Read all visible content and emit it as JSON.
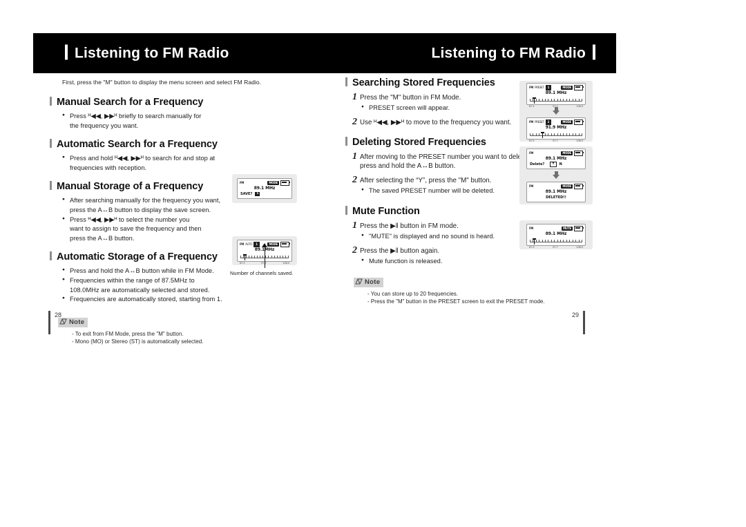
{
  "header": {
    "left_title": "Listening to FM Radio",
    "right_title": "Listening to FM Radio"
  },
  "left_page": {
    "intro": "First, press the \"M\" button to display the menu screen and select FM Radio.",
    "page_number": "28",
    "sections": [
      {
        "heading": "Manual Search for a Frequency",
        "bullets": [
          "Press ᴴ◀◀, ▶▶ᴴ briefly to search manually for",
          "the frequency you want."
        ]
      },
      {
        "heading": "Automatic Search for a Frequency",
        "bullets": [
          "Press and hold ᴴ◀◀, ▶▶ᴴ to search for and stop at",
          "frequencies with reception."
        ]
      },
      {
        "heading": "Manual Storage of a Frequency",
        "bullets": [
          "After searching manually for the frequency you want,",
          "press the A↔B button to display the save screen.",
          "Press ᴴ◀◀, ▶▶ᴴ to select the number you",
          "want to assign to save the frequency and then",
          "press the A↔B button."
        ]
      },
      {
        "heading": "Automatic Storage of a Frequency",
        "bullets": [
          "Press and hold the A↔B button while in FM Mode.",
          "Frequencies within the range of 87.5MHz to",
          "108.0MHz are automatically selected and stored.",
          "Frequencies are automatically stored, starting from 1."
        ]
      }
    ],
    "note": {
      "title": "Note",
      "items": [
        "- To exit from FM Mode, press the \"M\" button.",
        "- Mono (MO) or Stereo (ST) is automatically selected."
      ]
    },
    "callout": "Number of channels saved."
  },
  "right_page": {
    "page_number": "29",
    "sections": [
      {
        "heading": "Searching Stored Frequencies",
        "steps": [
          {
            "num": "1",
            "text": "Press the \"M\" button in FM Mode.",
            "sub": [
              "PRESET screen will appear."
            ]
          },
          {
            "num": "2",
            "text": "Use ᴴ◀◀, ▶▶ᴴ to move to the frequency you want.",
            "sub": []
          }
        ]
      },
      {
        "heading": "Deleting Stored Frequencies",
        "steps": [
          {
            "num": "1",
            "text": "After moving to the PRESET number you want to delete,",
            "text2": "press and hold the A↔B button.",
            "sub": []
          },
          {
            "num": "2",
            "text": "After selecting the “Y”, press the \"M\" button.",
            "sub": [
              "The saved PRESET number will be deleted."
            ]
          }
        ]
      },
      {
        "heading": "Mute Function",
        "steps": [
          {
            "num": "1",
            "text": "Press the ▶‖ button in FM mode.",
            "sub": [
              "\"MUTE\" is displayed and no sound is heard."
            ]
          },
          {
            "num": "2",
            "text": "Press the ▶‖ button again.",
            "sub": [
              "Mute function is released."
            ]
          }
        ]
      }
    ],
    "note": {
      "title": "Note",
      "items": [
        "- You can store up to 20 frequencies.",
        "- Press the \"M\" button in the PRESET screen to exit the PRESET mode."
      ]
    }
  },
  "lcd_screens": {
    "save": {
      "fm": "FM",
      "mode_badge": "MODE",
      "frequency": "89.1 MHz",
      "line3_label": "SAVE?",
      "line3_value": "1"
    },
    "auto_store": {
      "fm": "FM",
      "auto_label": "AUTO",
      "count": "1",
      "mode_badge": "MODE",
      "frequency": "89.1MHz",
      "scale_low": "87.5",
      "scale_mid": "97.7",
      "scale_high": "108.0"
    },
    "preset_1": {
      "fm": "FM",
      "preset_label": "PRESET",
      "preset_number": "1",
      "mode_badge": "MODE",
      "frequency": "89.1 MHz",
      "scale_low": "87.5",
      "scale_mid": "97.7",
      "scale_high": "108.0"
    },
    "preset_2": {
      "fm": "FM",
      "preset_label": "PRESET",
      "preset_number": "2",
      "mode_badge": "MODE",
      "frequency": "91.9 MHz",
      "scale_low": "87.5",
      "scale_mid": "97.7",
      "scale_high": "108.0"
    },
    "delete_confirm": {
      "fm": "FM",
      "mode_badge": "MODE",
      "frequency": "89.1 MHz",
      "line3_label": "Delete?",
      "yes": "Y",
      "no": "N"
    },
    "deleted": {
      "fm": "FM",
      "mode_badge": "MODE",
      "frequency": "89.1 MHz",
      "line3_label": "DELETED!!"
    },
    "mute": {
      "fm": "FM",
      "mute_badge": "MUTE",
      "frequency": "89.1 MHz",
      "scale_low": "87.5",
      "scale_mid": "97.7",
      "scale_high": "108.0"
    }
  }
}
